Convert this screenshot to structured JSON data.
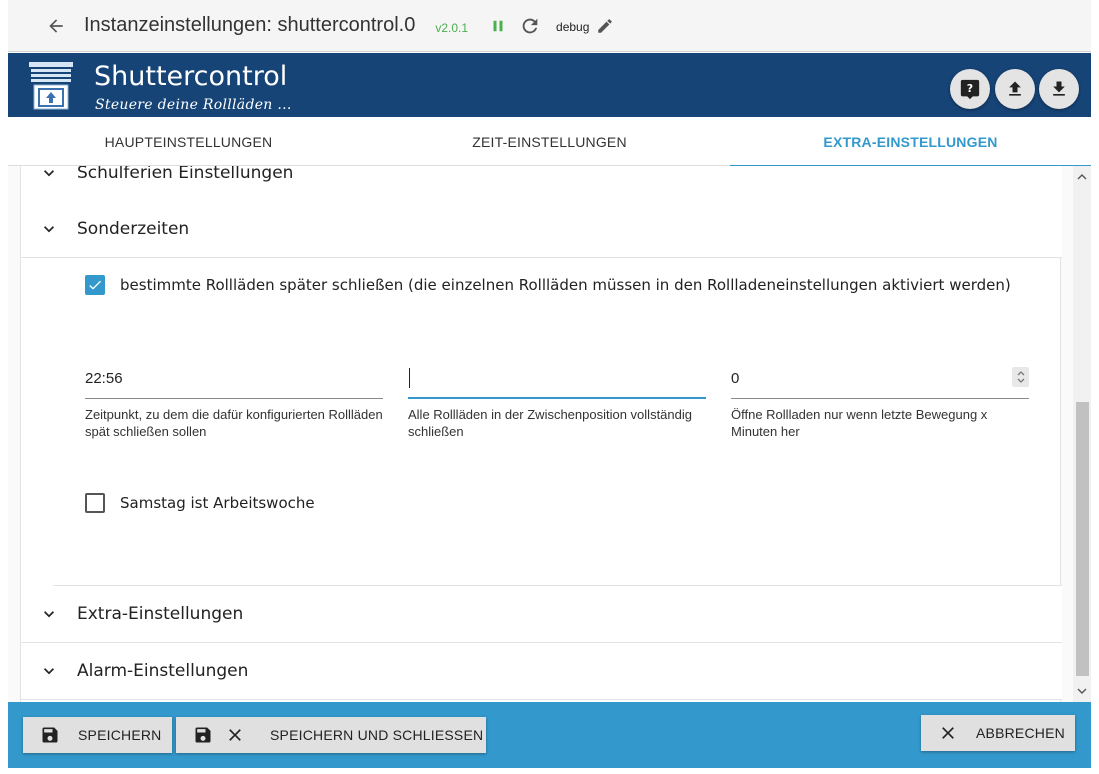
{
  "topbar": {
    "title": "Instanzeinstellungen: shuttercontrol.0",
    "version": "v2.0.1",
    "debug_label": "debug"
  },
  "header": {
    "app_name": "Shuttercontrol",
    "subtitle": "Steuere deine Rollläden ..."
  },
  "tabs": [
    {
      "label": "HAUPTEINSTELLUNGEN"
    },
    {
      "label": "ZEIT-EINSTELLUNGEN"
    },
    {
      "label": "EXTRA-EINSTELLUNGEN"
    }
  ],
  "panels": {
    "schulferien": "Schulferien Einstellungen",
    "sonderzeiten": "Sonderzeiten",
    "extra": "Extra-Einstellungen",
    "alarm": "Alarm-Einstellungen"
  },
  "sonderzeiten": {
    "late_close_checkbox": "bestimmte Rollläden später schließen (die einzelnen Rollläden müssen in den Rollladeneinstellungen aktiviert werden)",
    "time_value": "22:56",
    "time_helper": "Zeitpunkt, zu dem die dafür konfigurierten Rollläden spät schließen sollen",
    "intermediate_value": "",
    "intermediate_helper": "Alle Rollläden in der Zwischenposition vollständig schließen",
    "minutes_value": "0",
    "minutes_helper": "Öffne Rollladen nur wenn letzte Bewegung x Minuten her",
    "saturday_checkbox": "Samstag ist Arbeitswoche"
  },
  "footer": {
    "save": "SPEICHERN",
    "save_close": "SPEICHERN UND SCHLIESSEN",
    "cancel": "ABBRECHEN"
  },
  "colors": {
    "header_bg": "#164477",
    "accent": "#3399cc",
    "status_green": "#4caf50"
  }
}
